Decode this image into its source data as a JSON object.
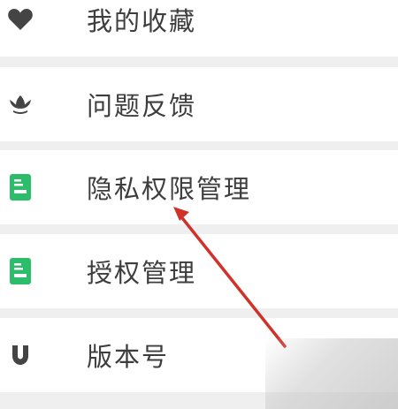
{
  "menu": {
    "items": [
      {
        "label": "我的收藏",
        "icon": "heart-icon"
      },
      {
        "label": "问题反馈",
        "icon": "lotus-icon"
      },
      {
        "label": "隐私权限管理",
        "icon": "document-icon"
      },
      {
        "label": "授权管理",
        "icon": "document-icon"
      },
      {
        "label": "版本号",
        "icon": "magnet-icon"
      }
    ]
  },
  "colors": {
    "row_background": "#ffffff",
    "separator": "#efefef",
    "text": "#3d3d3d",
    "icon_dark": "#444444",
    "icon_green": "#2bbd6a",
    "arrow": "#d0322a"
  }
}
